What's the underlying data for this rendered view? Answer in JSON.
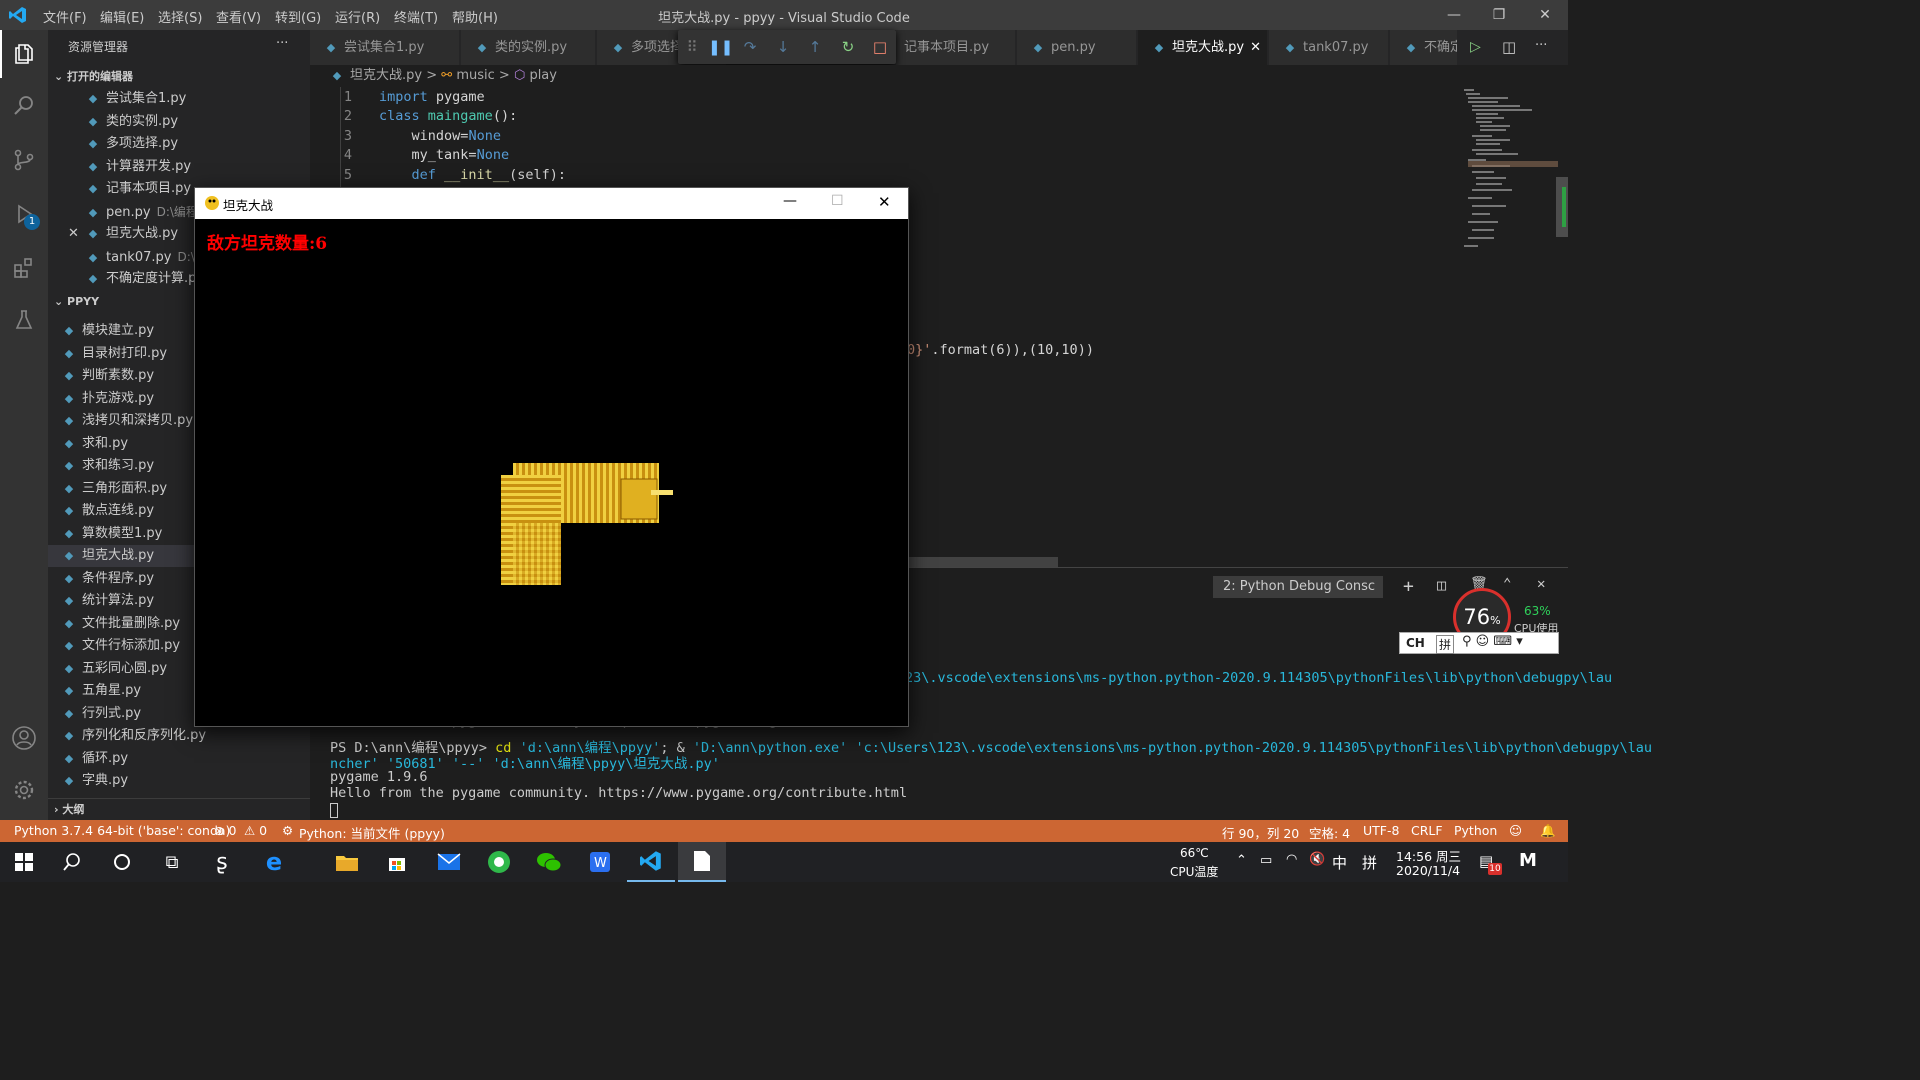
{
  "titlebar": {
    "menus": [
      "文件(F)",
      "编辑(E)",
      "选择(S)",
      "查看(V)",
      "转到(G)",
      "运行(R)",
      "终端(T)",
      "帮助(H)"
    ],
    "title": "坦克大战.py - ppyy - Visual Studio Code"
  },
  "activity": {
    "debug_badge": "1"
  },
  "sidebar": {
    "header": "资源管理器",
    "more": "···",
    "open_editors_label": "打开的编辑器",
    "open_editors": [
      {
        "name": "尝试集合1.py",
        "hint": ""
      },
      {
        "name": "类的实例.py",
        "hint": ""
      },
      {
        "name": "多项选择.py",
        "hint": ""
      },
      {
        "name": "计算器开发.py",
        "hint": ""
      },
      {
        "name": "记事本项目.py",
        "hint": ""
      },
      {
        "name": "pen.py",
        "hint": "D:\\编程"
      },
      {
        "name": "坦克大战.py",
        "hint": ""
      },
      {
        "name": "tank07.py",
        "hint": "D:\\编"
      },
      {
        "name": "不确定度计算.p",
        "hint": ""
      }
    ],
    "folder_label": "PPYY",
    "files": [
      "模块建立.py",
      "目录树打印.py",
      "判断素数.py",
      "扑克游戏.py",
      "浅拷贝和深拷贝.py",
      "求和.py",
      "求和练习.py",
      "三角形面积.py",
      "散点连线.py",
      "算数模型1.py",
      "坦克大战.py",
      "条件程序.py",
      "统计算法.py",
      "文件批量删除.py",
      "文件行标添加.py",
      "五彩同心圆.py",
      "五角星.py",
      "行列式.py",
      "序列化和反序列化.py",
      "循环.py",
      "字典.py"
    ],
    "outline_label": "大纲"
  },
  "tabs": [
    {
      "label": "尝试集合1.py"
    },
    {
      "label": "类的实例.py"
    },
    {
      "label": "多项选择"
    },
    {
      "label": "记事本项目.py"
    },
    {
      "label": "pen.py"
    },
    {
      "label": "坦克大战.py"
    },
    {
      "label": "tank07.py"
    },
    {
      "label": "不确定"
    }
  ],
  "breadcrumb": {
    "file": "坦克大战.py",
    "sep": ">",
    "cls": "music",
    "member": "play"
  },
  "code": {
    "line_numbers": [
      "1",
      "2",
      "3",
      "4",
      "5"
    ],
    "l1_kw": "import",
    "l1_mod": "pygame",
    "l2_kw": "class",
    "l2_name": "maingame",
    "l2_rest": "():",
    "l3_var": "window",
    "l3_eq": "=",
    "l3_val": "None",
    "l4_var": "my_tank",
    "l4_eq": "=",
    "l4_val": "None",
    "l5_kw": "def",
    "l5_name": "__init__",
    "l5_rest": "(self):",
    "partial_str": "0}'",
    "partial_rest": ".format(6)),(10,10))"
  },
  "panel": {
    "dropdown": "2: Python Debug Consc",
    "line1": "23\\.vscode\\extensions\\ms-python.python-2020.9.114305\\pythonFiles\\lib\\python\\debugpy\\lau",
    "line2_partial": "Hello from the pygame community. https://www.pygame.org/contribute.html",
    "line3_prompt": "PS D:\\ann\\编程\\ppyy>",
    "line3_cmd": " cd ",
    "line3_dir": "'d:\\ann\\编程\\ppyy'",
    "line3_amp": "; & ",
    "line3_exe": "'D:\\ann\\python.exe'",
    "line3_path": " 'c:\\Users\\123\\.vscode\\extensions\\ms-python.python-2020.9.114305\\pythonFiles\\lib\\python\\debugpy\\lau",
    "line4": "ncher' '50681' '--' 'd:\\ann\\编程\\ppyy\\坦克大战.py'",
    "line5": "pygame 1.9.6",
    "line6": "Hello from the pygame community. https://www.pygame.org/contribute.html"
  },
  "cpu_widget": {
    "usage": "76",
    "pct_sign": "%",
    "cpu_pct": "63%",
    "cpu_label": "CPU使用"
  },
  "ime": {
    "ch": "CH",
    "pin": "拼"
  },
  "game_window": {
    "title": "坦克大战",
    "enemy_label": "敌方坦克数量:6"
  },
  "statusbar": {
    "python": "Python 3.7.4 64-bit ('base': conda)",
    "errors": "⊗ 0",
    "warnings": "⚠ 0",
    "run": "Python: 当前文件 (ppyy)",
    "position": "行 90，列 20",
    "spaces": "空格: 4",
    "encoding": "UTF-8",
    "eol": "CRLF",
    "lang": "Python"
  },
  "taskbar": {
    "temp": "66℃",
    "temp_label": "CPU温度",
    "ime_zh": "中",
    "ime_pin": "拼",
    "time": "14:56 周三",
    "date": "2020/11/4",
    "notif": "10"
  },
  "colors": {
    "statusbar": "#cc6633",
    "enemy_text": "#ff0000",
    "tank": "#d8a820"
  }
}
